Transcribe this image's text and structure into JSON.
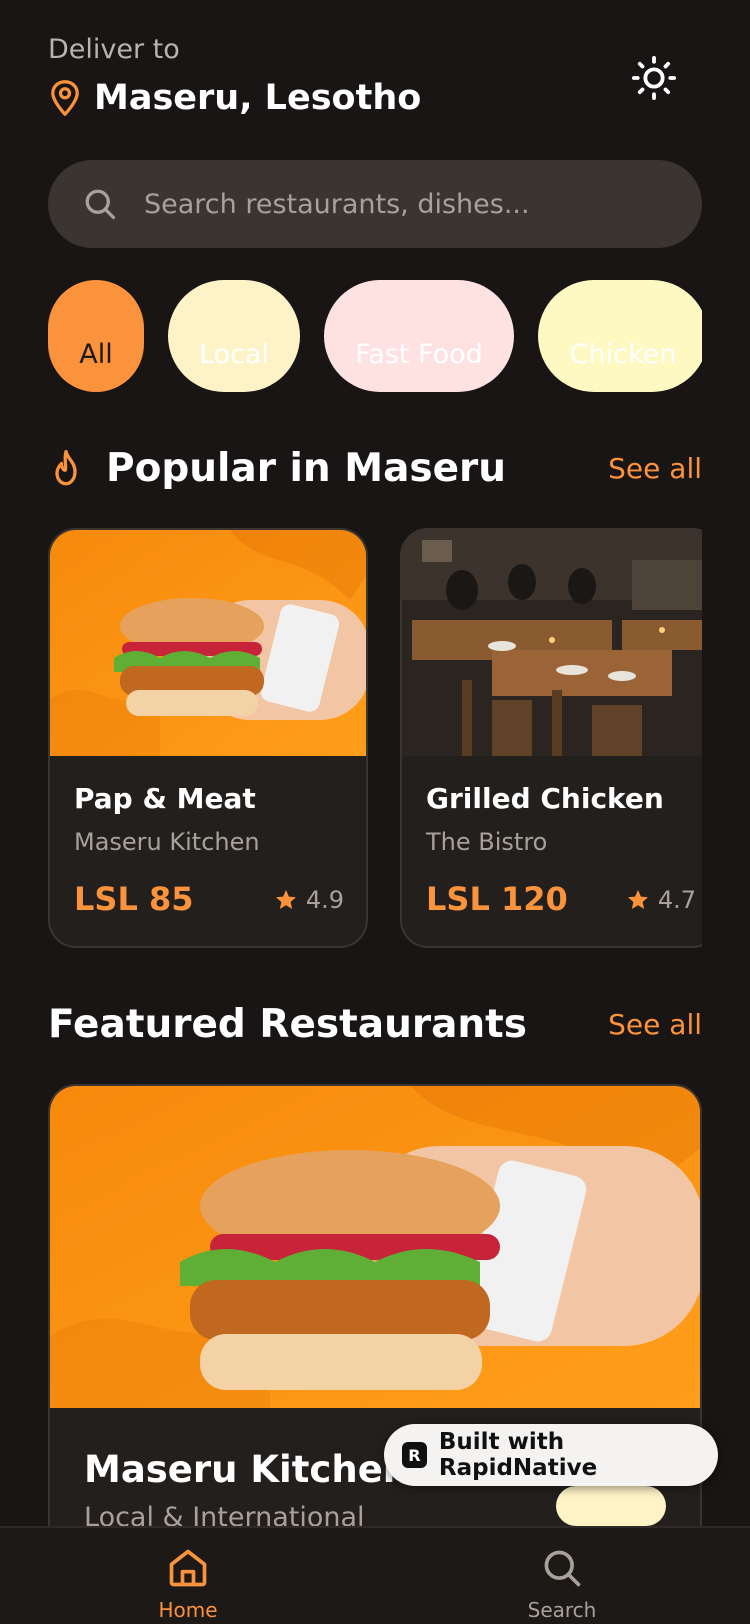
{
  "header": {
    "deliver_label": "Deliver to",
    "location": "Maseru, Lesotho",
    "location_icon": "map-pin-icon",
    "theme_icon": "sun-icon"
  },
  "search": {
    "placeholder": "Search restaurants, dishes...",
    "value": "",
    "icon": "search-icon"
  },
  "categories": [
    {
      "label": "All",
      "color": "#fb923c",
      "selected": true
    },
    {
      "label": "Local",
      "color": "#fef3c7",
      "selected": false
    },
    {
      "label": "Fast Food",
      "color": "#fee2e2",
      "selected": false
    },
    {
      "label": "Chicken",
      "color": "#fef9c3",
      "selected": false
    }
  ],
  "popular": {
    "icon": "flame-icon",
    "title": "Popular in Maseru",
    "see_all": "See all",
    "items": [
      {
        "name": "Pap & Meat",
        "restaurant": "Maseru Kitchen",
        "price": "LSL 85",
        "rating": "4.9",
        "image": "burger-photo"
      },
      {
        "name": "Grilled Chicken",
        "restaurant": "The Bistro",
        "price": "LSL 120",
        "rating": "4.7",
        "image": "restaurant-interior-photo"
      }
    ]
  },
  "featured": {
    "title": "Featured Restaurants",
    "see_all": "See all",
    "items": [
      {
        "name": "Maseru Kitchen",
        "cuisine": "Local & International",
        "image": "burger-photo"
      }
    ]
  },
  "badge": {
    "text": "Built with RapidNative",
    "logo_letter": "R"
  },
  "nav": {
    "items": [
      {
        "label": "Home",
        "icon": "home-icon",
        "active": true
      },
      {
        "label": "Search",
        "icon": "search-icon",
        "active": false
      }
    ]
  },
  "colors": {
    "background": "#181514",
    "accent": "#fb923c",
    "card": "#231f1d",
    "search_bg": "#3a3531"
  }
}
